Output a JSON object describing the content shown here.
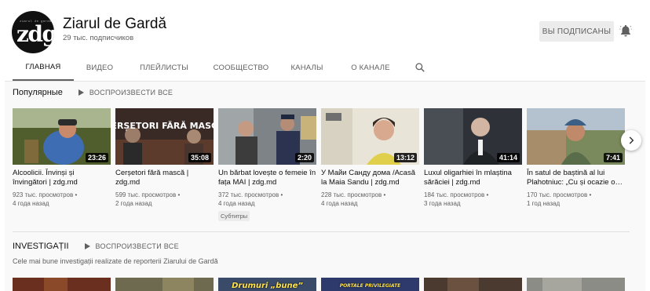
{
  "channel": {
    "avatar_pre": "ziarul de gardă",
    "avatar_logo": "zdg",
    "name": "Ziarul de Gardă",
    "subscribers": "29 тыс. подписчиков",
    "subscribe_label": "ВЫ ПОДПИСАНЫ"
  },
  "tabs": [
    {
      "label": "ГЛАВНАЯ",
      "active": true
    },
    {
      "label": "ВИДЕО"
    },
    {
      "label": "ПЛЕЙЛИСТЫ"
    },
    {
      "label": "СООБЩЕСТВО"
    },
    {
      "label": "КАНАЛЫ"
    },
    {
      "label": "О КАНАЛЕ"
    }
  ],
  "shelf1": {
    "title": "Популярные",
    "play_all": "ВОСПРОИЗВЕСТИ ВСЕ",
    "videos": [
      {
        "title": "Alcoolicii. Învinși și învingători | zdg.md",
        "views": "923 тыс. просмотров •",
        "age": "4 года назад",
        "duration": "23:26"
      },
      {
        "title": "Cerșetori fără mască | zdg.md",
        "views": "599 тыс. просмотров •",
        "age": "2 года назад",
        "duration": "35:08",
        "overlay": "CERȘETORI FĂRĂ MASCĂ"
      },
      {
        "title": "Un bărbat lovește o femeie în fața MAI | zdg.md",
        "views": "372 тыс. просмотров •",
        "age": "4 года назад",
        "duration": "2:20",
        "badge": "Субтитры"
      },
      {
        "title": "У Майи Санду дома /Acasă la Maia Sandu | zdg.md",
        "views": "228 тыс. просмотров •",
        "age": "4 года назад",
        "duration": "13:12"
      },
      {
        "title": "Luxul oligarhiei în mlaștina sărăciei | zdg.md",
        "views": "184 тыс. просмотров •",
        "age": "3 года назад",
        "duration": "41:14"
      },
      {
        "title": "În satul de baștină al lui Plahotniuc: „Cu și ocazie o…",
        "views": "170 тыс. просмотров •",
        "age": "1 год назад",
        "duration": "7:41"
      }
    ]
  },
  "shelf2": {
    "title": "INVESTIGAȚII",
    "play_all": "ВОСПРОИЗВЕСТИ ВСЕ",
    "description": "Cele mai bune investigații realizate de reporterii Ziarului de Gardă",
    "thumb_texts": [
      "",
      "",
      "Drumuri „bune”",
      "PORTALE PRIVILEGIATE",
      "",
      ""
    ]
  },
  "icons": {
    "bell": "bell-icon",
    "search": "search-icon",
    "play": "play-icon",
    "next": "chevron-right-icon"
  },
  "colors": {
    "accent": "#606060",
    "background": "#f9f9f9"
  }
}
